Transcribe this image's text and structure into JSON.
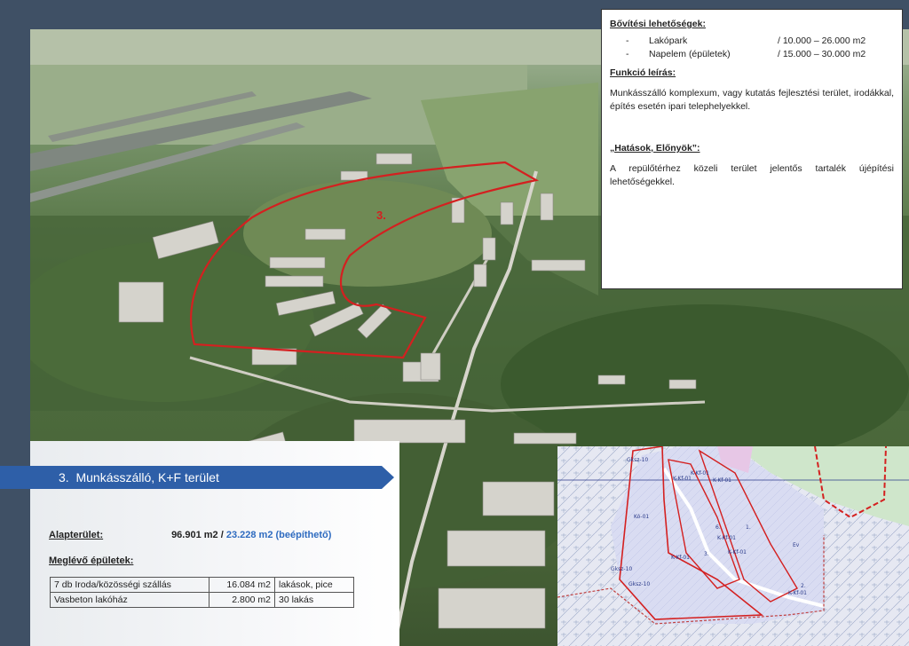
{
  "info": {
    "expansion_heading": "Bővítési lehetőségek:",
    "expansion_items": [
      {
        "dash": "-",
        "name": "Lakópark",
        "value": "/ 10.000 – 26.000 m2"
      },
      {
        "dash": "-",
        "name": "Napelem (épületek)",
        "value": "/ 15.000 – 30.000 m2"
      }
    ],
    "function_heading": "Funkció leírás:",
    "function_text": "Munkásszálló komplexum, vagy kutatás fejlesztési terület, irodákkal, építés esetén ipari telephelyekkel.",
    "effects_heading": "„Hatások, Előnyök”:",
    "effects_text": "A repülőtérhez közeli terület jelentős tartalék újépítési lehetőségekkel."
  },
  "photo": {
    "area_label": "3."
  },
  "panel": {
    "title": "3.  Munkásszálló, K+F terület",
    "base_area_label": "Alapterület:",
    "base_area_value": "96.901 m2 /",
    "buildable_value": "23.228 m2 (beépíthető)",
    "existing_label": "Meglévő épületek:",
    "buildings": [
      {
        "name": "7 db Iroda/közösségi szállás",
        "area": "16.084 m2",
        "note": "lakások, pice"
      },
      {
        "name": "Vasbeton lakóház",
        "area": "2.800 m2",
        "note": "30 lakás"
      }
    ]
  },
  "map": {
    "labels": [
      "Gksz-10",
      "K-Kf-01",
      "K-Kf-01",
      "K-Kf-01",
      "Kó-01",
      "K-Kf-01",
      "6.",
      "1.",
      "Ev",
      "K-Kf-01",
      "3.",
      "Gksz-10",
      "K-Kf-01",
      "Gksz-10",
      "2.",
      "K-Kf-01"
    ]
  },
  "colors": {
    "banner": "#2e5fa8",
    "highlight_value": "#2e6bc0",
    "boundary": "#d42020"
  }
}
